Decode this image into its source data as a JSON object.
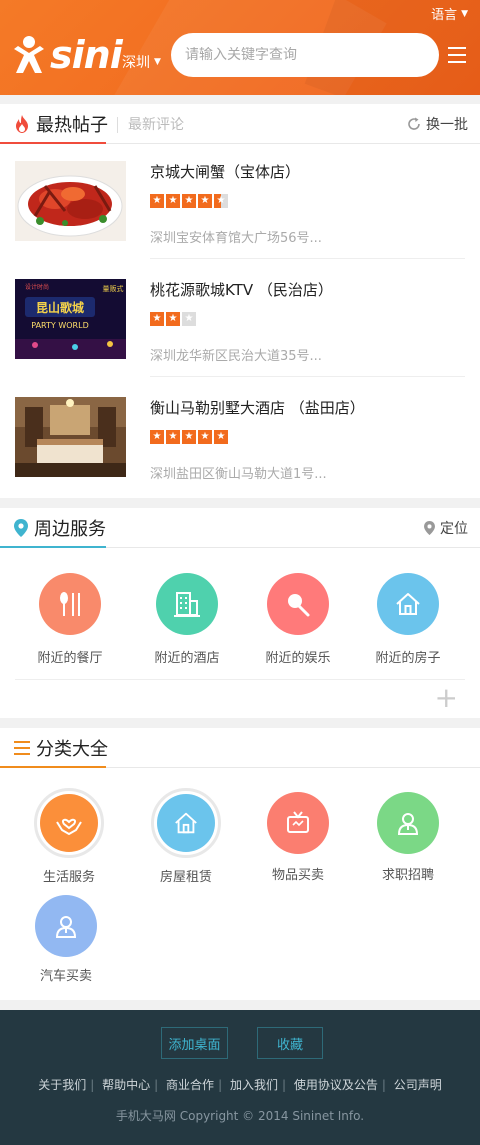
{
  "header": {
    "brand": "sini",
    "language_label": "语言",
    "city": "深圳",
    "search_placeholder": "请输入关键字查询"
  },
  "hot_posts": {
    "title": "最热帖子",
    "tab_latest": "最新评论",
    "refresh_label": "换一批",
    "items": [
      {
        "name": "京城大闸蟹（宝体店）",
        "rating": 4.5,
        "address": "深圳宝安体育馆大广场56号..."
      },
      {
        "name": "桃花源歌城KTV （民治店）",
        "rating": 2,
        "address": "深圳龙华新区民治大道35号..."
      },
      {
        "name": "衡山马勒别墅大酒店 （盐田店）",
        "rating": 5,
        "address": "深圳盐田区衡山马勒大道1号..."
      }
    ],
    "thumb_texts": {
      "ktv_sign": "昆山歌城",
      "ktv_sub": "PARTY WORLD",
      "ktv_top": "设计时尚",
      "ktv_right": "量贩式"
    }
  },
  "nearby": {
    "title": "周边服务",
    "locate_label": "定位",
    "items": [
      {
        "label": "附近的餐厅",
        "icon": "utensils-icon",
        "color": "#f98a6b"
      },
      {
        "label": "附近的酒店",
        "icon": "building-icon",
        "color": "#4fd1ad"
      },
      {
        "label": "附近的娱乐",
        "icon": "microphone-icon",
        "color": "#ff7a7a"
      },
      {
        "label": "附近的房子",
        "icon": "house-icon",
        "color": "#6bc4ec"
      }
    ],
    "more_symbol": "+"
  },
  "categories": {
    "title": "分类大全",
    "items": [
      {
        "label": "生活服务",
        "icon": "heart-hands-icon",
        "color": "#fb8f3a"
      },
      {
        "label": "房屋租赁",
        "icon": "house-icon",
        "color": "#6bc4ec"
      },
      {
        "label": "物品买卖",
        "icon": "tv-icon",
        "color": "#fb7e70"
      },
      {
        "label": "求职招聘",
        "icon": "person-icon",
        "color": "#7bd886"
      },
      {
        "label": "汽车买卖",
        "icon": "person-icon",
        "color": "#92b8f2"
      }
    ]
  },
  "footer": {
    "add_desktop": "添加桌面",
    "favorite": "收藏",
    "links": [
      "关于我们",
      "帮助中心",
      "商业合作",
      "加入我们",
      "使用协议及公告",
      "公司声明"
    ],
    "copyright": "手机大马网  Copyright © 2014 Sininet Info."
  },
  "colors": {
    "brand_orange": "#f26b1d",
    "footer_bg": "#243841",
    "accent_blue": "#3fb4cf"
  }
}
